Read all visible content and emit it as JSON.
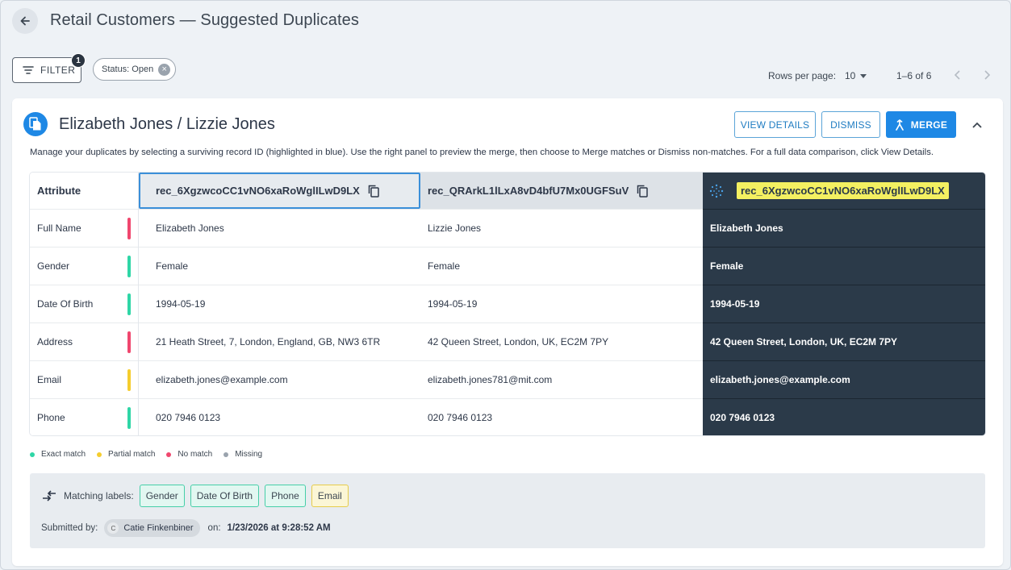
{
  "header": {
    "title": "Retail Customers — Suggested Duplicates",
    "back_icon": "arrow-left-icon"
  },
  "filter": {
    "label": "FILTER",
    "badge_count": "1",
    "chips": [
      {
        "label": "Status: Open"
      }
    ]
  },
  "pagination": {
    "rows_label": "Rows per page:",
    "rows_value": "10",
    "range": "1–6 of 6"
  },
  "card": {
    "title": "Elizabeth Jones / Lizzie Jones",
    "buttons": {
      "view_details": "VIEW DETAILS",
      "dismiss": "DISMISS",
      "merge": "MERGE"
    },
    "description": "Manage your duplicates by selecting a surviving record ID (highlighted in blue). Use the right panel to preview the merge, then choose to Merge matches or Dismiss non-matches. For a full data comparison, click View Details.",
    "table": {
      "attr_header": "Attribute",
      "record_a_id": "rec_6XgzwcoCC1vNO6xaRoWglILwD9LX",
      "record_b_id": "rec_QRArkL1lLxA8vD4bfU7Mx0UGFSuV",
      "preview_id": "rec_6XgzwcoCC1vNO6xaRoWglILwD9LX",
      "rows": [
        {
          "attribute": "Full Name",
          "status": "no_match",
          "a": "Elizabeth Jones",
          "b": "Lizzie Jones",
          "preview": "Elizabeth Jones"
        },
        {
          "attribute": "Gender",
          "status": "exact",
          "a": "Female",
          "b": "Female",
          "preview": "Female"
        },
        {
          "attribute": "Date Of Birth",
          "status": "exact",
          "a": "1994-05-19",
          "b": "1994-05-19",
          "preview": "1994-05-19"
        },
        {
          "attribute": "Address",
          "status": "no_match",
          "a": "21 Heath Street, 7, London, England, GB, NW3 6TR",
          "b": "42 Queen Street, London, UK, EC2M 7PY",
          "preview": "42 Queen Street, London, UK, EC2M 7PY"
        },
        {
          "attribute": "Email",
          "status": "partial",
          "a": "elizabeth.jones@example.com",
          "b": "elizabeth.jones781@mit.com",
          "preview": "elizabeth.jones@example.com"
        },
        {
          "attribute": "Phone",
          "status": "exact",
          "a": "020 7946 0123",
          "b": "020 7946 0123",
          "preview": "020 7946 0123"
        }
      ]
    },
    "legend": [
      {
        "label": "Exact match",
        "color": "#2fd6a6"
      },
      {
        "label": "Partial match",
        "color": "#f5cd2e"
      },
      {
        "label": "No match",
        "color": "#f0476e"
      },
      {
        "label": "Missing",
        "color": "#9aa3ad"
      }
    ],
    "matching": {
      "label": "Matching labels:",
      "tags": [
        {
          "label": "Gender",
          "kind": "exact"
        },
        {
          "label": "Date Of Birth",
          "kind": "exact"
        },
        {
          "label": "Phone",
          "kind": "exact"
        },
        {
          "label": "Email",
          "kind": "partial"
        }
      ]
    },
    "submitted": {
      "label": "Submitted by:",
      "user_initial": "C",
      "user": "Catie Finkenbiner",
      "on_label": "on:",
      "date": "1/23/2026 at 9:28:52 AM"
    }
  },
  "colors": {
    "exact": "#2fd6a6",
    "partial": "#f5cd2e",
    "no_match": "#f0476e",
    "missing": "#9aa3ad",
    "accent": "#1e88e5",
    "preview_bg": "#2b3a49"
  }
}
